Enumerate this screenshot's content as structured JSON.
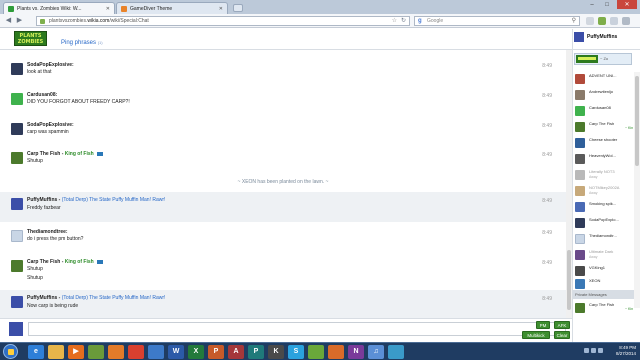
{
  "browser": {
    "tabs": [
      {
        "label": "Plants vs. Zombies Wiki: W...",
        "active": true
      },
      {
        "label": "GameDiver Theme",
        "active": false
      }
    ],
    "url_prefix": "plantsvszombies.",
    "url_domain": "wikia.com",
    "url_path": "/wiki/Special:Chat",
    "search_placeholder": "Google"
  },
  "chat": {
    "logo_text": "PLANTS ZOMBIES",
    "ping_label": "Ping phrases",
    "ping_suffix": "(1)",
    "current_user": "PuffyMuffins",
    "messages": [
      {
        "user": "SodaPopExplosive:",
        "title": "",
        "kof": "",
        "lines": [
          "look at that"
        ],
        "time": "8:49",
        "alt": false,
        "avatar": "#2f3b59"
      },
      {
        "user": "Cardusan08:",
        "title": "",
        "kof": "",
        "lines": [
          "DID YOU FORGOT ABOUT FREEDY CARP?!"
        ],
        "time": "8:49",
        "alt": false,
        "avatar": "#3fb24d"
      },
      {
        "user": "SodaPopExplosive:",
        "title": "",
        "kof": "",
        "lines": [
          "carp was spammin"
        ],
        "time": "8:49",
        "alt": false,
        "avatar": "#2f3b59"
      },
      {
        "user": "Carp The Fish",
        "title": "",
        "kof": "King of Fish",
        "lines": [
          "Shutup"
        ],
        "time": "8:49",
        "alt": false,
        "avatar": "#4c7a2c"
      },
      {
        "user": "PuffyMuffins",
        "title": "(Total Derp) The State Puffy Muffin Man! Rawr!",
        "kof": "",
        "lines": [
          "Freddy fazbear"
        ],
        "time": "8:49",
        "alt": true,
        "avatar": "#3b4ea8"
      },
      {
        "user": "Thediamondtree:",
        "title": "",
        "kof": "",
        "lines": [
          "do i press the pm button?"
        ],
        "time": "8:49",
        "alt": false,
        "avatar": "#c9d6e6"
      },
      {
        "user": "Carp The Fish",
        "title": "",
        "kof": "King of Fish",
        "lines": [
          "Shutup",
          "Shutup"
        ],
        "time": "8:49",
        "alt": false,
        "avatar": "#4c7a2c"
      },
      {
        "user": "PuffyMuffins",
        "title": "(Total Derp) The State Puffy Muffin Man! Rawr!",
        "kof": "",
        "lines": [
          "Now carp is being rude"
        ],
        "time": "8:49",
        "alt": true,
        "avatar": "#3b4ea8"
      }
    ],
    "inline_alert": "~ XEON has been planted on the lawn. ~"
  },
  "userlist": {
    "room_label": "~ Zo",
    "users": [
      {
        "name": "ADVENT UNI...",
        "sub": "",
        "tag": "",
        "avatar": "#b14a3a",
        "away": false
      },
      {
        "name": "Andrewtienljo",
        "sub": "",
        "tag": "",
        "avatar": "#8a7a6a",
        "away": false
      },
      {
        "name": "Cardusan08",
        "sub": "",
        "tag": "",
        "avatar": "#3fb24d",
        "away": false
      },
      {
        "name": "Carp The Fish",
        "sub": "",
        "tag": "~ Kin",
        "avatar": "#4c7a2c",
        "away": false
      },
      {
        "name": "Cheese shooter",
        "sub": "",
        "tag": "",
        "avatar": "#2f5f9a",
        "away": false
      },
      {
        "name": "HeavenlyWol...",
        "sub": "",
        "tag": "",
        "avatar": "#5a5a5a",
        "away": false
      },
      {
        "name": "Literally NOT3",
        "sub": "Away",
        "tag": "",
        "avatar": "#b9b9b9",
        "away": true
      },
      {
        "name": "NOTMikey2002A",
        "sub": "Away",
        "tag": "",
        "avatar": "#c7a97a",
        "away": true
      },
      {
        "name": "Smoking spik...",
        "sub": "",
        "tag": "",
        "avatar": "#4a6ab5",
        "away": false
      },
      {
        "name": "SodaPopExplo...",
        "sub": "",
        "tag": "",
        "avatar": "#2f3b59",
        "away": false
      },
      {
        "name": "Thediamondtr...",
        "sub": "",
        "tag": "",
        "avatar": "#c9d6e6",
        "away": false
      },
      {
        "name": "Ultimate Dark",
        "sub": "Away",
        "tag": "",
        "avatar": "#6a4a8a",
        "away": true
      },
      {
        "name": "VGKing1",
        "sub": "",
        "tag": "",
        "avatar": "#4a4a4a",
        "away": false
      },
      {
        "name": "XEON",
        "sub": "",
        "tag": "",
        "avatar": "#3a78b5",
        "away": false
      }
    ],
    "private_messages_label": "Private Messages",
    "pm_users": [
      {
        "name": "Carp The Fish",
        "tag": "~ Kin",
        "avatar": "#4c7a2c"
      }
    ]
  },
  "buttons": {
    "pm": "PM",
    "afk": "AFK",
    "multikick": "Multikick",
    "clear": "Clear"
  },
  "taskbar": {
    "time": "8:49 PM",
    "date": "8/27/2014",
    "apps": [
      {
        "name": "ie-icon",
        "color": "#2e7fd8",
        "letter": "e"
      },
      {
        "name": "explorer-icon",
        "color": "#e7b54a",
        "letter": ""
      },
      {
        "name": "media-player-icon",
        "color": "#e56d1e",
        "letter": "▶"
      },
      {
        "name": "minecraft-icon",
        "color": "#6a9a3a",
        "letter": ""
      },
      {
        "name": "firefox-icon",
        "color": "#e37b2a",
        "letter": ""
      },
      {
        "name": "chrome-icon",
        "color": "#d9402f",
        "letter": ""
      },
      {
        "name": "paint-icon",
        "color": "#3d7ac9",
        "letter": ""
      },
      {
        "name": "word-icon",
        "color": "#2b5aa8",
        "letter": "W"
      },
      {
        "name": "excel-icon",
        "color": "#237a3c",
        "letter": "X"
      },
      {
        "name": "powerpoint-icon",
        "color": "#c75a2a",
        "letter": "P"
      },
      {
        "name": "access-icon",
        "color": "#a4373a",
        "letter": "A"
      },
      {
        "name": "publisher-icon",
        "color": "#1f7a7a",
        "letter": "P"
      },
      {
        "name": "k-app-icon",
        "color": "#4a4a4a",
        "letter": "K"
      },
      {
        "name": "skype-icon",
        "color": "#2aa2de",
        "letter": "S"
      },
      {
        "name": "pvz-icon",
        "color": "#6aa83a",
        "letter": ""
      },
      {
        "name": "browser-icon",
        "color": "#d96b2a",
        "letter": ""
      },
      {
        "name": "onenote-icon",
        "color": "#7a3a9a",
        "letter": "N"
      },
      {
        "name": "itunes-icon",
        "color": "#5b8fd6",
        "letter": "♫"
      },
      {
        "name": "photos-icon",
        "color": "#3a9ac9",
        "letter": ""
      }
    ]
  }
}
